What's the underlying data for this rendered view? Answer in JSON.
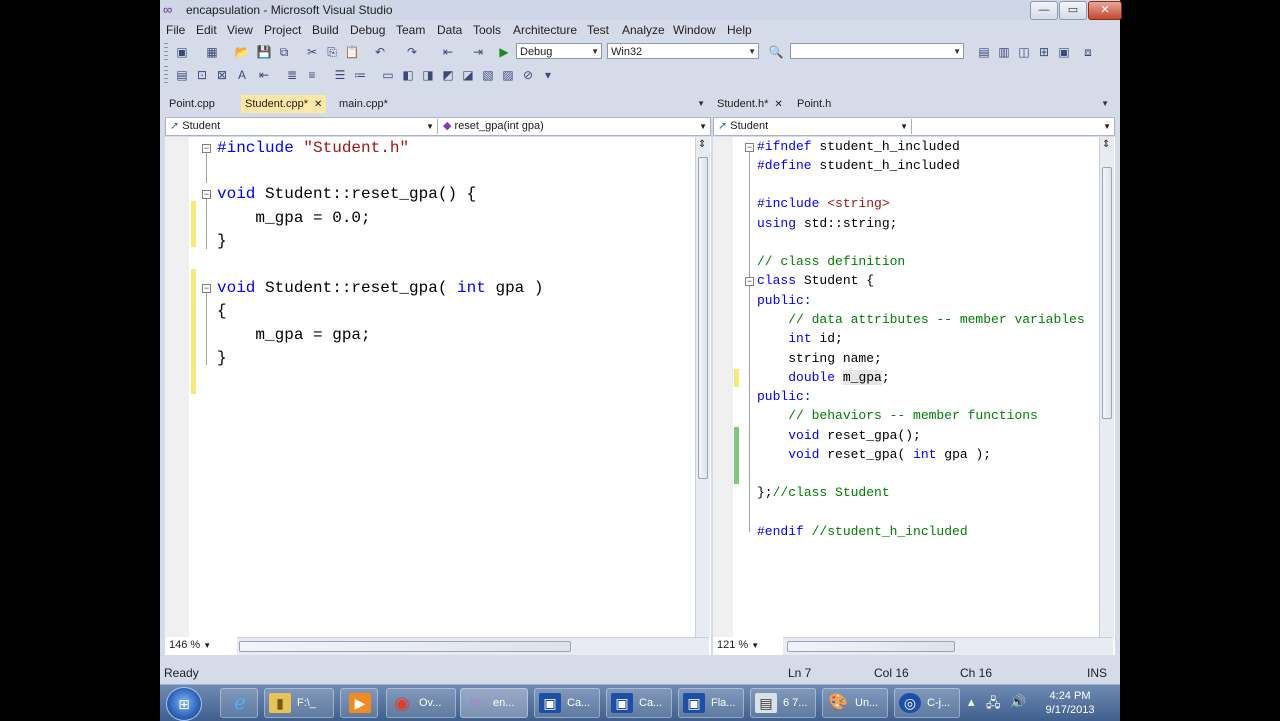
{
  "window": {
    "title": "encapsulation - Microsoft Visual Studio",
    "min_glyph": "—",
    "max_glyph": "▭",
    "close_glyph": "✕"
  },
  "menu": [
    "File",
    "Edit",
    "View",
    "Project",
    "Build",
    "Debug",
    "Team",
    "Data",
    "Tools",
    "Architecture",
    "Test",
    "Analyze",
    "Window",
    "Help"
  ],
  "toolbar": {
    "config": "Debug",
    "platform": "Win32",
    "find": ""
  },
  "left_editor": {
    "tabs": [
      {
        "label": "Point.cpp"
      },
      {
        "label": "Student.cpp*"
      },
      {
        "label": "main.cpp*"
      }
    ],
    "nav_class": "Student",
    "nav_member": "reset_gpa(int gpa)",
    "zoom": "146 %",
    "lines": [
      [
        "#include ",
        "\"Student.h\""
      ],
      [
        ""
      ],
      [
        "void Student::reset_gpa() {"
      ],
      [
        "    m_gpa = 0.0;"
      ],
      [
        "}"
      ],
      [
        ""
      ],
      [
        "void Student::reset_gpa( int gpa )"
      ],
      [
        "{"
      ],
      [
        "    m_gpa = gpa;"
      ],
      [
        "}"
      ]
    ]
  },
  "right_editor": {
    "tabs": [
      {
        "label": "Student.h*"
      },
      {
        "label": "Point.h"
      }
    ],
    "nav_class": "Student",
    "nav_member": "",
    "zoom": "121 %",
    "lines": [
      "#ifndef student_h_included",
      "#define student_h_included",
      "",
      "#include <string>",
      "using std::string;",
      "",
      "// class definition",
      "class Student {",
      "public:",
      "    // data attributes -- member variables",
      "    int id;",
      "    string name;",
      "    double m_gpa;",
      "public:",
      "    // behaviors -- member functions",
      "    void reset_gpa();",
      "    void reset_gpa( int gpa );",
      "",
      "};//class Student",
      "",
      "#endif //student_h_included"
    ]
  },
  "status": {
    "text": "Ready",
    "ln": "Ln 7",
    "col": "Col 16",
    "ch": "Ch 16",
    "mode": "INS"
  },
  "taskbar": {
    "items": [
      "F:\\_",
      "Ov...",
      "en...",
      "Ca...",
      "Ca...",
      "Fla...",
      "6 7...",
      "Un...",
      "C-j..."
    ],
    "time": "4:24 PM",
    "date": "9/17/2013",
    "colors": {
      "accent": "#3f5f8d"
    }
  }
}
